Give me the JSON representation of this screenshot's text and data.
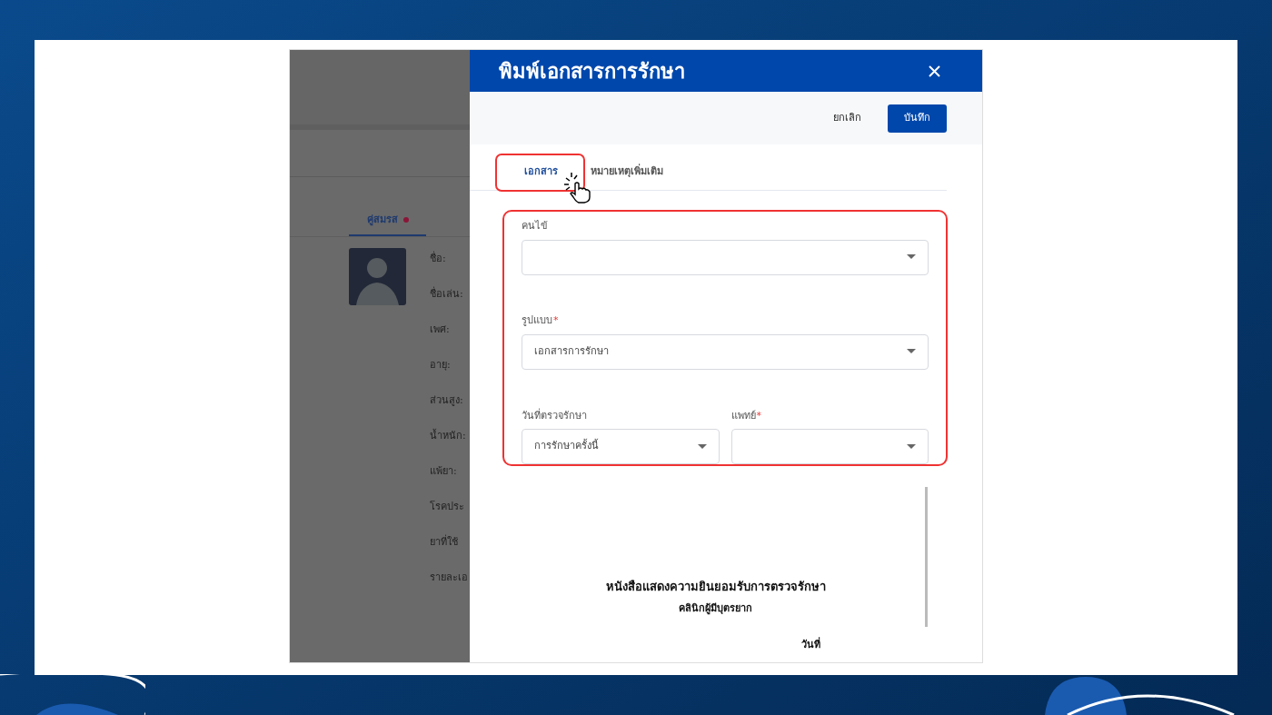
{
  "background_page": {
    "tab": {
      "label": "คู่สมรส",
      "selected": true,
      "has_dot": true
    },
    "profile_labels": [
      "ชื่อ:",
      "ชื่อเล่น:",
      "เพศ:",
      "อายุ:",
      "ส่วนสูง:",
      "น้ำหนัก:",
      "แพ้ยา:",
      "โรคประ",
      "ยาที่ใช้",
      "รายละเอ"
    ]
  },
  "dialog": {
    "title": "พิมพ์เอกสารการรักษา",
    "cancel": "ยกเลิก",
    "save": "บันทึก",
    "tabs": [
      {
        "label": "เอกสาร",
        "selected": true
      },
      {
        "label": "หมายเหตุเพิ่มเติม",
        "selected": false
      }
    ],
    "fields": [
      {
        "label": "คนไข้"
      },
      {
        "label": "รูปแบบ",
        "required_mark": "*",
        "value": "เอกสารการรักษา"
      },
      {
        "label": "วันที่ตรวจรักษา",
        "value": "การรักษาครั้งนี้"
      },
      {
        "label": "แพทย์",
        "required_mark": "*"
      }
    ],
    "preview": {
      "title": "หนังสือแสดงความยินยอมรับการตรวจรักษา",
      "subtitle": "คลินิกผู้มีบุตรยาก",
      "date_label": "วันที่"
    }
  }
}
